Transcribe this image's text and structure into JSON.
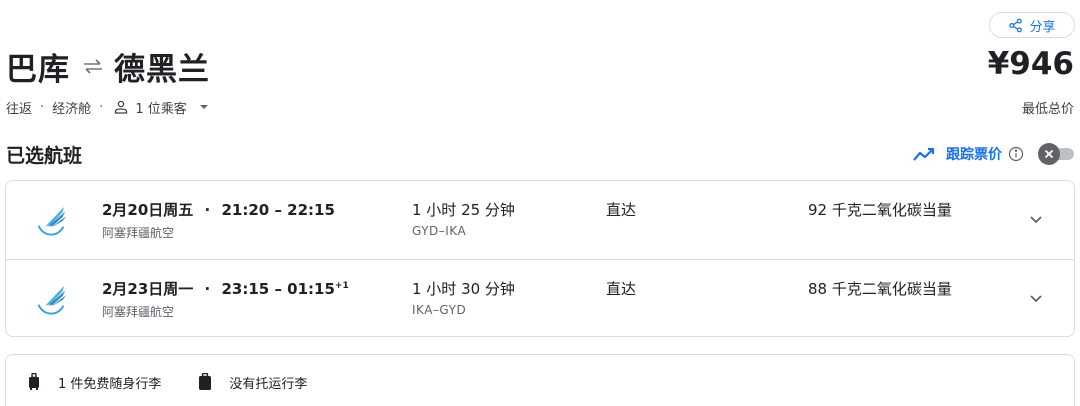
{
  "header": {
    "share_label": "分享",
    "origin": "巴库",
    "destination": "德黑兰",
    "price": "¥946",
    "price_caption": "最低总价",
    "trip_type": "往返",
    "cabin_class": "经济舱",
    "passengers": "1 位乘客"
  },
  "selected": {
    "title": "已选航班",
    "track_label": "跟踪票价",
    "track_enabled": false
  },
  "flights": [
    {
      "date": "2月20日周五",
      "times": "21:20 – 22:15",
      "day_offset": "",
      "airline": "阿塞拜疆航空",
      "duration": "1 小时 25 分钟",
      "airports": "GYD–IKA",
      "stops": "直达",
      "emissions": "92 千克二氧化碳当量"
    },
    {
      "date": "2月23日周一",
      "times": "23:15 – 01:15",
      "day_offset": "+1",
      "airline": "阿塞拜疆航空",
      "duration": "1 小时 30 分钟",
      "airports": "IKA–GYD",
      "stops": "直达",
      "emissions": "88 千克二氧化碳当量"
    }
  ],
  "baggage": {
    "carry_on": "1 件免费随身行李",
    "checked": "没有托运行李"
  },
  "colors": {
    "accent": "#1a73e8",
    "text": "#202124",
    "secondary_text": "#5f6368",
    "border": "#dadce0"
  }
}
